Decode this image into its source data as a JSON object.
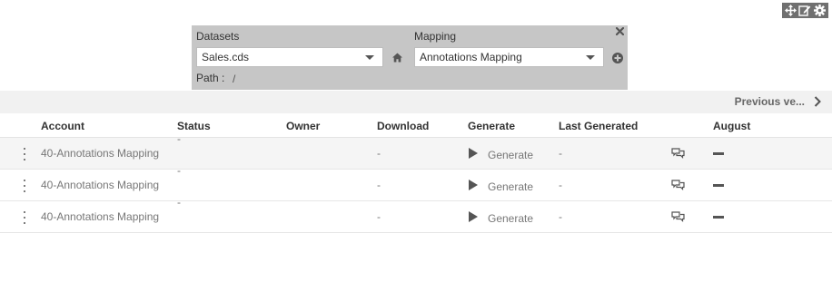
{
  "toolbar": {
    "icons": [
      "move-icon",
      "edit-icon",
      "gear-icon"
    ]
  },
  "filters": {
    "datasets_label": "Datasets",
    "dataset_value": "Sales.cds",
    "mapping_label": "Mapping",
    "mapping_value": "Annotations Mapping",
    "path_label": "Path :",
    "path_value": "/"
  },
  "previous_versions": {
    "label": "Previous ve..."
  },
  "table": {
    "columns": {
      "account": "Account",
      "status": "Status",
      "owner": "Owner",
      "download": "Download",
      "generate": "Generate",
      "last_generated": "Last Generated",
      "month": "August"
    },
    "rows": [
      {
        "account": "40-Annotations Mapping",
        "status": "-",
        "download": "-",
        "generate": "Generate",
        "last_generated": "-"
      },
      {
        "account": "40-Annotations Mapping",
        "status": "-",
        "download": "-",
        "generate": "Generate",
        "last_generated": "-"
      },
      {
        "account": "40-Annotations Mapping",
        "status": "-",
        "download": "-",
        "generate": "Generate",
        "last_generated": "-"
      }
    ]
  },
  "colors": {
    "panel": "#c6c6c6",
    "toolbar": "#707070",
    "row_shade": "#f5f5f5"
  }
}
